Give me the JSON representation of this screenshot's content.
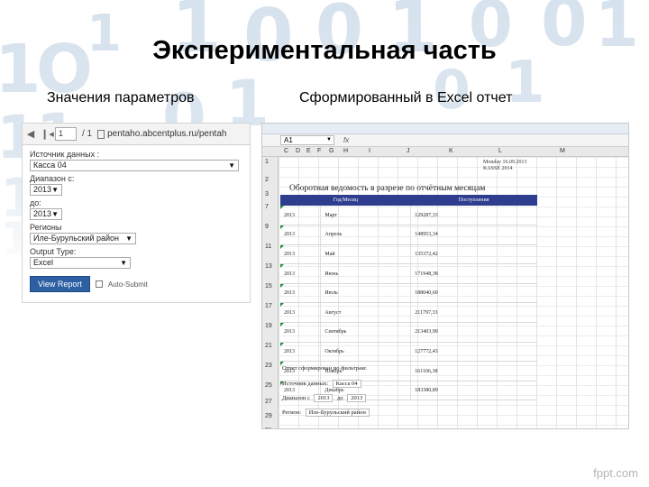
{
  "slide": {
    "title": "Экспериментальная часть",
    "left_subtitle": "Значения параметров",
    "right_subtitle": "Сформированный в Excel отчет",
    "brand": "fppt.com"
  },
  "browser": {
    "page_number": "1",
    "page_total": "/ 1",
    "url": "pentaho.abcentplus.ru/pentah",
    "params": [
      {
        "label": "Источник данных :",
        "value": "Касса 04"
      },
      {
        "label": "Диапазон с:",
        "value": "2013"
      },
      {
        "label": "до:",
        "value": "2013"
      },
      {
        "label": "Регионы",
        "value": "Иле-Бурульский район"
      },
      {
        "label": "Output Type:",
        "value": "Excel"
      }
    ],
    "view_button": "View Report",
    "auto_submit": "Auto-Submit"
  },
  "excel": {
    "name_box": "A1",
    "fx": "fx",
    "columns": [
      "C",
      "D",
      "E",
      "F",
      "G",
      "H",
      "I",
      "J",
      "K",
      "L",
      "M"
    ],
    "row_numbers": [
      "1",
      "2",
      "3",
      "7",
      "9",
      "11",
      "13",
      "15",
      "17",
      "19",
      "21",
      "23",
      "25",
      "27",
      "29",
      "31",
      "32"
    ],
    "meta_line1": "Monday 16.09.2013",
    "meta_line2": "KASSE 2014",
    "report_title": "Оборотная ведомость в разрезе по отчётным месяцам",
    "headers": [
      "Год/Месяц",
      "Поступления"
    ],
    "rows": [
      {
        "year": "2013",
        "month": "Март",
        "value": "129287,33"
      },
      {
        "year": "2013",
        "month": "Апрель",
        "value": "148953,34"
      },
      {
        "year": "2013",
        "month": "Май",
        "value": "135372,42"
      },
      {
        "year": "2013",
        "month": "Июнь",
        "value": "171948,38"
      },
      {
        "year": "2013",
        "month": "Июль",
        "value": "188040,60"
      },
      {
        "year": "2013",
        "month": "Август",
        "value": "211797,33"
      },
      {
        "year": "2013",
        "month": "Сентябрь",
        "value": "213403,99"
      },
      {
        "year": "2013",
        "month": "Октябрь",
        "value": "127772,43"
      },
      {
        "year": "2013",
        "month": "Ноябрь",
        "value": "161106,38"
      },
      {
        "year": "2013",
        "month": "Декабрь",
        "value": "183380,89"
      }
    ],
    "footer_title": "Отчет сформирован по фильтрам:",
    "footer_source_label": "Источник данных:",
    "footer_source_value": "Касса 04",
    "footer_range_label": "Диапазон с",
    "footer_range_from": "2013",
    "footer_range_to_label": "до",
    "footer_range_to": "2013",
    "footer_region_label": "Регион:",
    "footer_region_value": "Иле-Бурульский район"
  }
}
